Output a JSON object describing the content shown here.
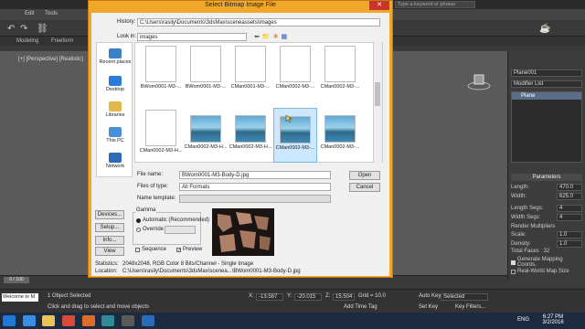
{
  "app": {
    "menu": [
      "Edit",
      "Tools"
    ],
    "ribbon": [
      "Modeling",
      "Freeform"
    ],
    "search_placeholder": "Type a keyword or phrase",
    "viewport_label": "[+] [Perspective] [Realistic]"
  },
  "dialog": {
    "title": "Select Bitmap Image File",
    "history_label": "History:",
    "history_value": "C:\\Users\\rasily\\Documents\\3dsMax\\sceneassets\\images",
    "look_in_label": "Look in:",
    "look_in_value": "images",
    "places": [
      "Recent places",
      "Desktop",
      "Libraries",
      "This PC",
      "Network"
    ],
    "files": [
      {
        "name": "BWom0001-M3-...",
        "kind": "doc"
      },
      {
        "name": "BWom0001-M3-...",
        "kind": "doc"
      },
      {
        "name": "CMan0001-M3-...",
        "kind": "doc"
      },
      {
        "name": "CMan0002-M3-...",
        "kind": "doc"
      },
      {
        "name": "CMan0002-M3-...",
        "kind": "doc"
      },
      {
        "name": "CMan0002-M3-H...",
        "kind": "doc"
      },
      {
        "name": "CMan0002-M3-H...",
        "kind": "img"
      },
      {
        "name": "CMan0002-M3-H...",
        "kind": "img"
      },
      {
        "name": "CMan0002-M3-...",
        "kind": "img",
        "selected": true
      },
      {
        "name": "CMan0002-M3-...",
        "kind": "img"
      }
    ],
    "file_name_label": "File name:",
    "file_name_value": "BWom0001-M3-Body-D.jpg",
    "files_of_type_label": "Files of type:",
    "files_of_type_value": "All Formats",
    "name_template_label": "Name template:",
    "open_label": "Open",
    "cancel_label": "Cancel",
    "side_buttons": [
      "Devices...",
      "Setup...",
      "Info...",
      "View"
    ],
    "gamma_label": "Gamma",
    "gamma_auto": "Automatic (Recommended)",
    "gamma_override": "Override",
    "sequence_label": "Sequence",
    "preview_label": "Preview",
    "statistics_label": "Statistics:",
    "statistics_value": "2048x2048, RGB Color 8 Bits/Channel - Single Image",
    "location_label": "Location:",
    "location_value": "C:\\Users\\rasily\\Documents\\3dsMax\\scenea...\\BWom0001-M3-Body-D.jpg"
  },
  "cmdpanel": {
    "object_name": "Plane001",
    "modifier_list": "Modifier List",
    "stack_item": "Plane",
    "params_title": "Parameters",
    "rows": [
      {
        "label": "Length:",
        "value": "470.0"
      },
      {
        "label": "Width:",
        "value": "625.0"
      },
      {
        "label": "Length Segs:",
        "value": "4"
      },
      {
        "label": "Width Segs:",
        "value": "4"
      }
    ],
    "render_mult": "Render Multipliers",
    "scale_label": "Scale:",
    "scale_value": "1.0",
    "density_label": "Density:",
    "density_value": "1.0",
    "total_faces": "Total Faces : 32",
    "gen_mapping": "Generate Mapping Coords.",
    "real_world": "Real-World Map Size"
  },
  "statusbar": {
    "objects_selected": "1 Object Selected",
    "hint": "Click and drag to select and move objects",
    "x": "-13.587",
    "y": "-20.015",
    "z": "15.504",
    "grid": "Grid = 10.0",
    "autokey": "Auto Key",
    "selected": "Selected",
    "setkey": "Set Key",
    "keyfilters": "Key Filters...",
    "add_time_tag": "Add Time Tag",
    "welcome": "Welcome to M",
    "timeline_pos": "0 / 100"
  },
  "taskbar": {
    "time": "6:27 PM",
    "date": "3/2/2016",
    "lang": "ENG"
  }
}
